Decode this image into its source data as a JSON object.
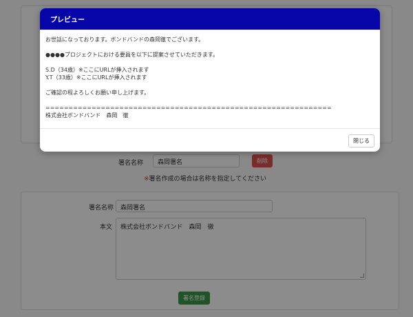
{
  "modal": {
    "title": "プレビュー",
    "lines": [
      "お世話になっております。ボンドバンドの森岡徹でございます。",
      "",
      "●●●●プロジェクトにおける要員を以下に提案させていただきます。",
      "",
      "S.D（34歳）※ここにURLが挿入されます",
      "Y.T（33歳）※ここにURLが挿入されます",
      "",
      "ご確認の程よろしくお願い申し上げます。",
      "",
      "==============================================================",
      "株式会社ボンドバンド　森岡　徹"
    ],
    "close_label": "閉じる"
  },
  "signature": {
    "label": "署名名称",
    "selected": "森岡署名",
    "delete_label": "削除",
    "note_mark": "※",
    "note_text": "署名作成の場合は名称を指定してください"
  },
  "edit": {
    "name_label": "署名名称",
    "name_value": "森岡署名",
    "body_label": "本文",
    "body_value": "株式会社ボンドバンド　森岡　徹",
    "register_label": "署名登録"
  },
  "colors": {
    "header": "#0505a8",
    "delete": "#d9534f",
    "register": "#3a9a4a"
  }
}
